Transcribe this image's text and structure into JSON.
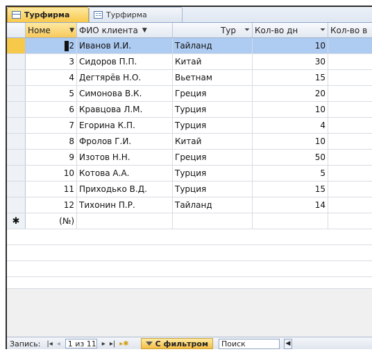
{
  "tabs": [
    {
      "label": "Турфирма",
      "icon": "table-icon",
      "active": true
    },
    {
      "label": "Турфирма",
      "icon": "form-icon",
      "active": false
    }
  ],
  "columns": {
    "num": "Номе",
    "fio": "ФИО клиента",
    "tur": "Тур",
    "kol": "Кол-во дн",
    "kol2": "Кол-во в"
  },
  "rows": [
    {
      "num": "2",
      "fio": "Иванов И.И.",
      "tur": "Тайланд",
      "kol": "10"
    },
    {
      "num": "3",
      "fio": "Сидоров П.П.",
      "tur": "Китай",
      "kol": "30"
    },
    {
      "num": "4",
      "fio": "Дегтярёв Н.О.",
      "tur": "Вьетнам",
      "kol": "15"
    },
    {
      "num": "5",
      "fio": "Симонова В.К.",
      "tur": "Греция",
      "kol": "20"
    },
    {
      "num": "6",
      "fio": "Кравцова Л.М.",
      "tur": "Турция",
      "kol": "10"
    },
    {
      "num": "7",
      "fio": "Егорина К.П.",
      "tur": "Турция",
      "kol": "4"
    },
    {
      "num": "8",
      "fio": "Фролов Г.И.",
      "tur": "Китай",
      "kol": "10"
    },
    {
      "num": "9",
      "fio": "Изотов Н.Н.",
      "tur": "Греция",
      "kol": "50"
    },
    {
      "num": "10",
      "fio": "Котова А.А.",
      "tur": "Турция",
      "kol": "5"
    },
    {
      "num": "11",
      "fio": "Приходько В.Д.",
      "tur": "Турция",
      "kol": "15"
    },
    {
      "num": "12",
      "fio": "Тихонин П.Р.",
      "tur": "Тайланд",
      "kol": "14"
    }
  ],
  "new_row": {
    "marker": "✱",
    "num": "(№)"
  },
  "status": {
    "label": "Запись:",
    "first": "|◂",
    "prev": "◂",
    "record": "1 из 11",
    "next": "▸",
    "last": "▸|",
    "new": "▸✱",
    "filter_label": "С фильтром",
    "search_placeholder": "Поиск"
  },
  "colors": {
    "selected_row": "#aecbf2",
    "active_tab": "#f9c84c",
    "border": "#d6dbe3"
  }
}
